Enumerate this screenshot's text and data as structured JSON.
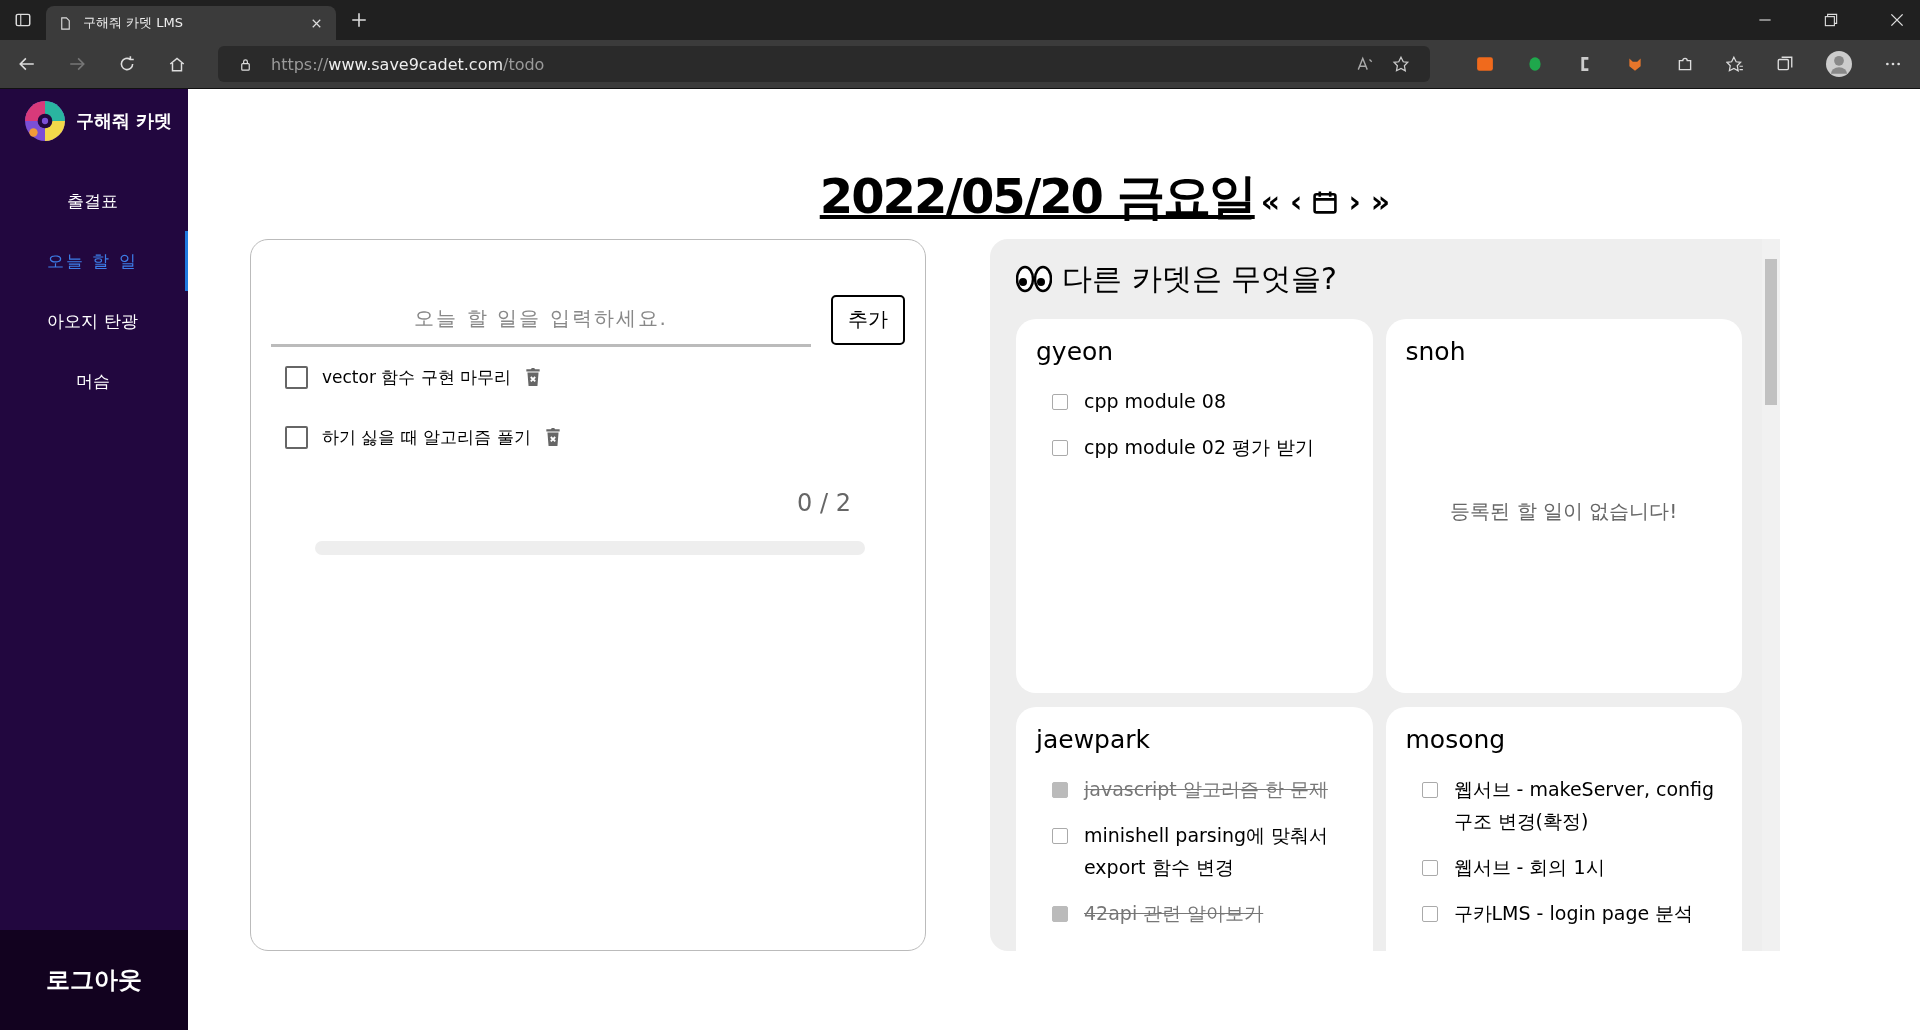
{
  "browser": {
    "tab_title": "구해줘 카뎃 LMS",
    "url_prefix": "https://",
    "url_host": "www.save9cadet.com",
    "url_path": "/todo"
  },
  "sidebar": {
    "brand": "구해줘 카뎃",
    "items": [
      {
        "label": "출결표",
        "selected": false
      },
      {
        "label": "오늘 할 일",
        "selected": true
      },
      {
        "label": "아오지 탄광",
        "selected": false
      },
      {
        "label": "머슴",
        "selected": false
      }
    ],
    "logout": "로그아웃"
  },
  "header": {
    "date": "2022/05/20 금요일",
    "nav": [
      "«",
      "‹",
      "›",
      "»"
    ]
  },
  "my_todo": {
    "placeholder": "오늘 할 일을 입력하세요.",
    "add_button": "추가",
    "items": [
      {
        "text": "vector 함수 구현 마무리",
        "checked": false
      },
      {
        "text": "하기 싫을 때 알고리즘 풀기",
        "checked": false
      }
    ],
    "count": "0 / 2",
    "level": 0
  },
  "others": {
    "title": "다른 카뎃은 무엇을?",
    "cadets": [
      {
        "name": "gyeon",
        "todos": [
          {
            "text": "cpp module 08",
            "checked": false
          },
          {
            "text": "cpp module 02 평가 받기",
            "checked": false
          }
        ]
      },
      {
        "name": "snoh",
        "empty": "등록된 할 일이 없습니다!"
      },
      {
        "name": "jaewpark",
        "todos": [
          {
            "text": "javascript 알고리즘 한 문제",
            "checked": true
          },
          {
            "text": "minishell parsing에 맞춰서 export 함수 변경",
            "checked": false
          },
          {
            "text": "42api 관련 알아보기",
            "checked": true
          }
        ]
      },
      {
        "name": "mosong",
        "todos": [
          {
            "text": "웹서브 - makeServer, config 구조 변경(확정)",
            "checked": false
          },
          {
            "text": "웹서브 - 회의 1시",
            "checked": false
          },
          {
            "text": "구카LMS - login page 분석",
            "checked": false
          }
        ]
      }
    ]
  }
}
